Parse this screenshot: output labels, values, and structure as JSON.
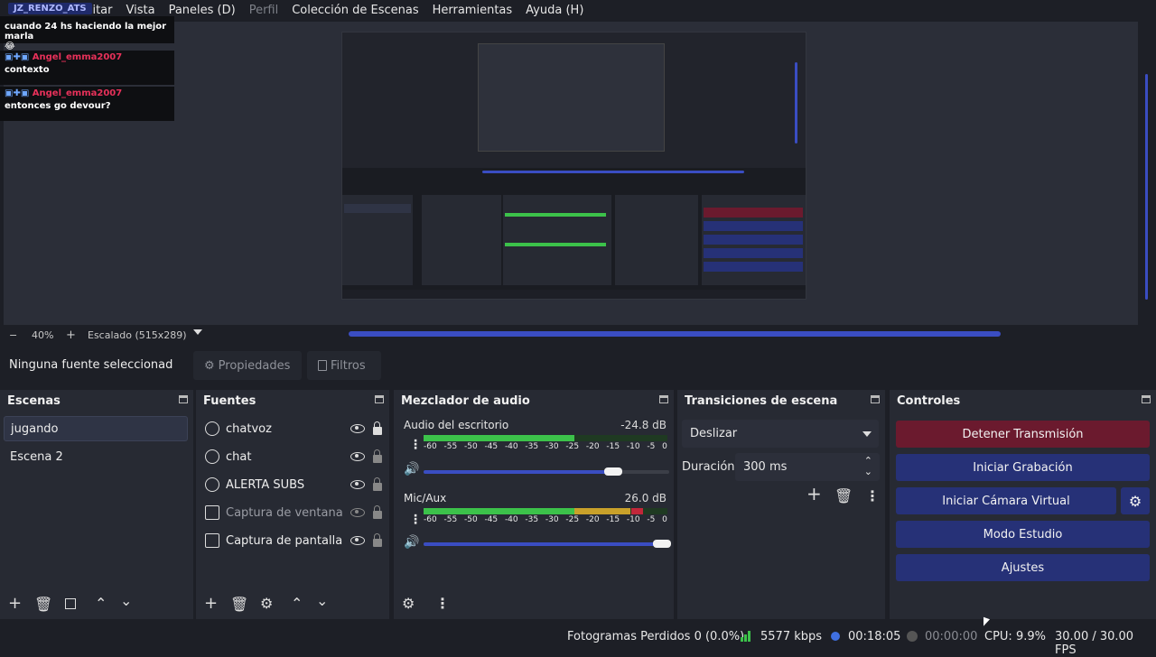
{
  "menu": {
    "items": [
      "Editar",
      "Vista",
      "Paneles (D)",
      "Perfil",
      "Colección de Escenas",
      "Herramientas",
      "Ayuda (H)"
    ],
    "overlay_user": "JZ_RENZO_ATS"
  },
  "chat_overlay": {
    "message1": "cuando 24 hs haciendo la mejor marla",
    "emoji1": "😂",
    "user2": "Angel_emma2007",
    "message2": "contexto",
    "user3": "Angel_emma2007",
    "message3": "entonces go devour?"
  },
  "zoom": {
    "minus": "−",
    "level": "40%",
    "plus": "+",
    "scaling": "Escalado (515x289)"
  },
  "properties_bar": {
    "no_source": "Ninguna fuente seleccionad",
    "properties_button": "Propiedades",
    "filters_button": "Filtros"
  },
  "scenes": {
    "title": "Escenas",
    "items": [
      {
        "label": "jugando",
        "selected": true
      },
      {
        "label": "Escena 2",
        "selected": false
      }
    ]
  },
  "sources": {
    "title": "Fuentes",
    "items": [
      {
        "label": "chatvoz",
        "icon": "globe-icon",
        "visible": true
      },
      {
        "label": "chat",
        "icon": "globe-icon",
        "visible": true
      },
      {
        "label": "ALERTA SUBS",
        "icon": "globe-icon",
        "visible": true
      },
      {
        "label": "Captura de ventana",
        "icon": "window-icon",
        "visible": false
      },
      {
        "label": "Captura de pantalla",
        "icon": "monitor-icon",
        "visible": true
      }
    ]
  },
  "mixer": {
    "title": "Mezclador de audio",
    "channels": [
      {
        "name": "Audio del escritorio",
        "db": "-24.8 dB",
        "volume": 0.8,
        "level": 0.62
      },
      {
        "name": "Mic/Aux",
        "db": "26.0 dB",
        "volume": 1.0,
        "level": 0.9
      }
    ],
    "ticks": [
      "-60",
      "-55",
      "-50",
      "-45",
      "-40",
      "-35",
      "-30",
      "-25",
      "-20",
      "-15",
      "-10",
      "-5",
      "0"
    ]
  },
  "transitions": {
    "title": "Transiciones de escena",
    "selected": "Deslizar",
    "duration_label": "Duración",
    "duration_value": "300 ms"
  },
  "controls": {
    "title": "Controles",
    "stop_stream": "Detener Transmisión",
    "start_recording": "Iniciar Grabación",
    "start_virtual_cam": "Iniciar Cámara Virtual",
    "studio_mode": "Modo Estudio",
    "settings": "Ajustes"
  },
  "status": {
    "dropped_frames": "Fotogramas Perdidos 0 (0.0%)",
    "bitrate": "5577 kbps",
    "stream_time": "00:18:05",
    "rec_time": "00:00:00",
    "cpu": "CPU: 9.9%",
    "fps": "30.00 / 30.00 FPS"
  },
  "colors": {
    "accent_blue": "#263177",
    "stop_red": "#6b1a2e",
    "meter_green": "#3cc24a",
    "meter_yellow": "#c9a12a",
    "meter_red": "#c2273a"
  }
}
